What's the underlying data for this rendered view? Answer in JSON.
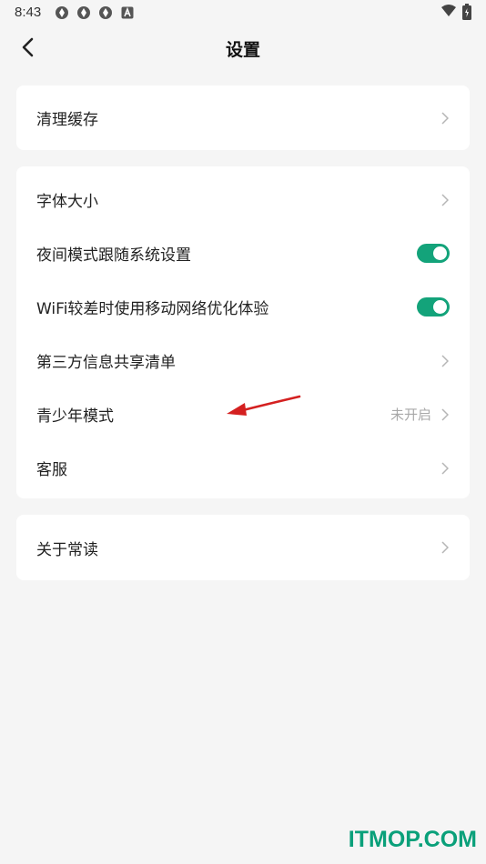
{
  "status_bar": {
    "time": "8:43",
    "notification_icons": [
      "app-icon",
      "app-icon",
      "app-icon",
      "a-icon"
    ],
    "system_icons": [
      "wifi-icon",
      "battery-icon"
    ]
  },
  "header": {
    "title": "设置",
    "back_icon": "chevron-left-icon"
  },
  "card1": {
    "items": [
      {
        "label": "清理缓存"
      }
    ]
  },
  "card2": {
    "items": [
      {
        "label": "字体大小",
        "type": "link"
      },
      {
        "label": "夜间模式跟随系统设置",
        "type": "toggle",
        "on": true
      },
      {
        "label": "WiFi较差时使用移动网络优化体验",
        "type": "toggle",
        "on": true
      },
      {
        "label": "第三方信息共享清单",
        "type": "link"
      },
      {
        "label": "青少年模式",
        "type": "link",
        "value": "未开启"
      },
      {
        "label": "客服",
        "type": "link"
      }
    ]
  },
  "card3": {
    "items": [
      {
        "label": "关于常读"
      }
    ]
  },
  "colors": {
    "accent": "#13a37a",
    "background": "#f5f5f5",
    "card": "#ffffff",
    "annotation": "#d42020",
    "watermark": "#0aa07a"
  },
  "watermark": "ITMOP.COM"
}
